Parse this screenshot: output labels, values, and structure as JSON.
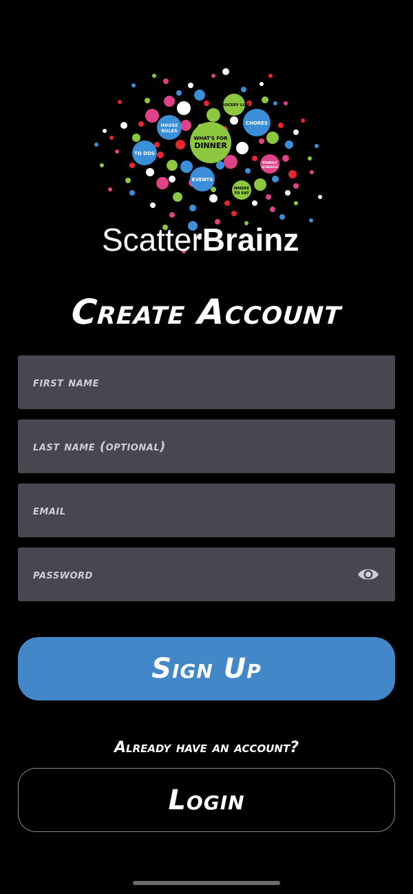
{
  "logo": {
    "brand_light": "Scatter",
    "brand_bold": "Brainz",
    "bubbles": {
      "grocery": "GROCERY LIST",
      "house_rules_1": "HOUSE",
      "house_rules_2": "RULES",
      "chores": "CHORES",
      "whats_for_1": "WHAT'S FOR",
      "whats_for_2": "DINNER",
      "to_dos": "TO DOS",
      "family_1": "FAMILY",
      "family_2": "SCHEDULE",
      "events": "EVENTS",
      "where_1": "WHERE",
      "where_2": "TO EAT"
    }
  },
  "title": "Create Account",
  "form": {
    "first_name_placeholder": "first name",
    "last_name_placeholder": "last name (optional)",
    "email_placeholder": "email",
    "password_placeholder": "password"
  },
  "signup_label": "Sign Up",
  "login_prompt": "Already have an account?",
  "login_label": "Login",
  "colors": {
    "background": "#000000",
    "field": "#48464f",
    "primary": "#4288c8",
    "pink": "#e0428a",
    "green": "#8dc63f",
    "blue": "#3a8fd8"
  }
}
